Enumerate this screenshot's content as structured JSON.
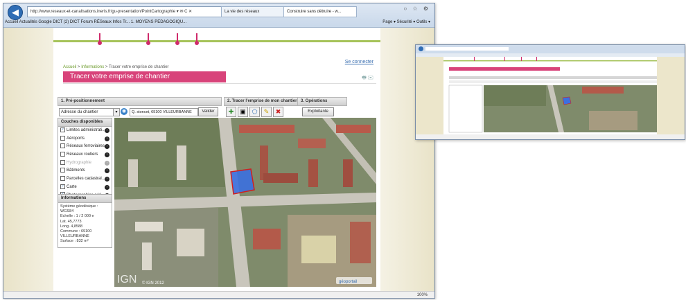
{
  "browser": {
    "address": "http://www.reseaux-et-canalisations.ineris.fr/gu-presentation/PointCartographie",
    "address_controls": "▾ ✉ C ✕",
    "tabs": [
      "La vie des réseaux",
      "Construire sans détruire - w..."
    ],
    "bookmarks": "Accueil   Actualités   Google   DICT (2)   DICT   Forum RÉSeaux   Infos Tr...   1. MOYENS PEDAGOGIQU...",
    "toolbar_right": "Page ▾   Sécurité ▾   Outils ▾",
    "window_controls": "○ ☆ ⚙",
    "zoom": "100%"
  },
  "page": {
    "connect_label": "Se connecter",
    "breadcrumb": {
      "home": "Accueil",
      "info": "Informations",
      "current": "Tracer votre emprise de chantier"
    },
    "title": "Tracer votre emprise de chantier"
  },
  "sections": {
    "pre_positioning": "1. Pré-positionnement",
    "draw": "2. Tracer l'emprise de mon chantier",
    "operations": "3. Opérations"
  },
  "search": {
    "type_value": "Adresse du chantier",
    "query": "Q. stoncet, 69100 VILLEURBANNE",
    "validate_label": "Valider"
  },
  "operations": {
    "exploit_label": "Exploitante"
  },
  "layers": {
    "title": "Couches disponibles",
    "items": [
      {
        "label": "Limites administrati...",
        "checked": true,
        "enabled": true
      },
      {
        "label": "Aéroports",
        "checked": false,
        "enabled": true
      },
      {
        "label": "Réseaux ferroviaires",
        "checked": false,
        "enabled": true
      },
      {
        "label": "Réseaux routiers",
        "checked": false,
        "enabled": true
      },
      {
        "label": "Hydrographie",
        "checked": false,
        "enabled": false
      },
      {
        "label": "Bâtiments",
        "checked": false,
        "enabled": true
      },
      {
        "label": "Parcelles cadastral...",
        "checked": false,
        "enabled": true
      },
      {
        "label": "Carte",
        "checked": true,
        "enabled": true
      },
      {
        "label": "Photographies aéri...",
        "checked": true,
        "enabled": true
      }
    ]
  },
  "info": {
    "title": "Informations",
    "lines": [
      "Système géodésique : WGS84",
      "Echelle : 1 / 2 000 e",
      "Lat. 45,7773",
      "Long. 4,8588",
      "Commune : 69100",
      "VILLEURBANNE",
      "Surface : 832 m²"
    ]
  },
  "map": {
    "watermark": "IGN",
    "copyright": "© IGN 2012",
    "badge": "géoportail",
    "polygon_color": "#3b6fe0"
  },
  "colors": {
    "accent_pink": "#d8437a",
    "green_bar": "#a6c35a"
  }
}
